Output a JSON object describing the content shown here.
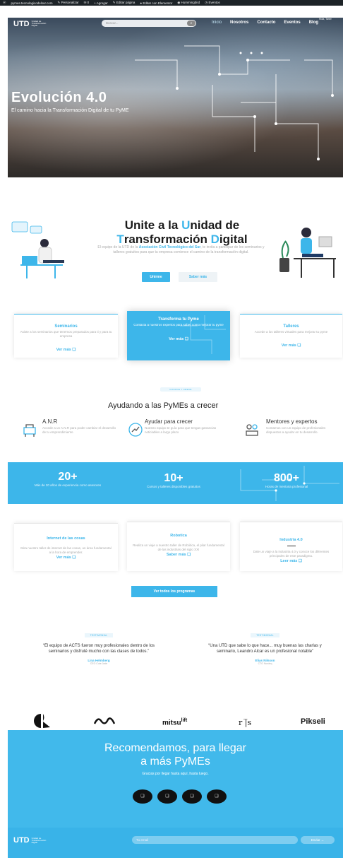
{
  "wpbar": {
    "site": "pymes.tecnologicodelsur.com",
    "customize": "Personalizar",
    "comments": "0",
    "new": "Agregar",
    "edit": "Editar página",
    "elementor": "Editar con Elementor",
    "notifications": "Hummingbird",
    "events": "Eventos"
  },
  "nav": {
    "logo": "UTD",
    "logo_sub": "Unidad de Transformación Digital",
    "search_placeholder": "Buscar...",
    "hello": "Hola, Taner",
    "items": [
      "Inicio",
      "Nosotros",
      "Contacto",
      "Eventos",
      "Blog"
    ]
  },
  "hero": {
    "title": "Evolución 4.0",
    "subtitle": "El camino hacia la Transformación Digital de tu PyME"
  },
  "unite": {
    "line1a": "Unite a la ",
    "line1b": "U",
    "line1c": "nidad de",
    "line2a": "T",
    "line2b": "ransformación ",
    "line2c": "D",
    "line2d": "igital",
    "intro_a": "El equipo de la UTD de la ",
    "intro_strong": "Asociación Civil Tecnológico del Sur",
    "intro_b": ", te invita a participar de los seminarios y talleres gratuitos para que tu empresa comience el camino de la transformación digital.",
    "btn_join": "Unirme",
    "btn_more": "Saber más"
  },
  "cards": [
    {
      "title": "Seminarios",
      "desc": "Asiste a los seminarios que tenemos preparados para ti y para tu empresa",
      "more": "Ver más ❑"
    },
    {
      "title": "Transforma tu Pyme",
      "desc": "Contacta a nuestros expertos para saber como mejorar tu pyme",
      "more": "Ver más ❑"
    },
    {
      "title": "Talleres",
      "desc": "Accede a los talleres virtuales para mejorar tu pyme",
      "more": "Ver más ❑"
    }
  ],
  "help": {
    "pill": "CONOCE Y CRECE",
    "title": "Ayudando a las PyMEs a crecer",
    "items": [
      {
        "title": "A.N.R",
        "desc": "Accede a un A.N.R para poder cambiar el desarrollo de tu emprendimiento"
      },
      {
        "title": "Ayudar para crecer",
        "desc": "Nuestro equipo te guía para que tengas ganancias noticiables a largo plazo"
      },
      {
        "title": "Mentores y expertos",
        "desc": "Contamos con un equipo de profesionales dispuestos a ayudar en tu desarrollo."
      }
    ]
  },
  "stats": [
    {
      "n": "20+",
      "l": "Más de 20 años de experiencia como asesores"
    },
    {
      "n": "10+",
      "l": "Cursos y talleres disponibles gratuitos"
    },
    {
      "n": "800+",
      "l": "Horas de mentoria profesional"
    }
  ],
  "programs": [
    {
      "title": "Internet de las cosas",
      "desc": "Mira nuestro taller de internet de las cosas, un área fundamental a la hora de emprender.",
      "more": "Ver más ❑"
    },
    {
      "title": "Robotica",
      "desc": "Realiza un viaje a nuestro taller de Robótica, el pilar fundamental de las industrias del siglo XXI",
      "more": "Saber más ❑"
    },
    {
      "title": "Industria 4.0",
      "desc": "Dale un viaje a la industria 4.0 y conoce los diferentes principales de este paradigma.",
      "more": "Leer más ❑"
    }
  ],
  "all_programs": "Ver todos los programas",
  "testimonials": [
    {
      "tag": "TESTIMONIAL",
      "quote": "“El equipo de ACTS fueron muy profesionales dentro de los seminarios y disfruté mucho con las clases de todos.”",
      "name": "Lina Helmberg",
      "role": "CEO Cute Jade"
    },
    {
      "tag": "TESTIMONIAL",
      "quote": "“Una UTD que sabe lo que hace... muy buenas las charlas y seminario, Leandro Alcar es un profesional notable”",
      "name": "Elias Nilsson",
      "role": "CTO Nordeq"
    }
  ],
  "logos": [
    "mitsu",
    "lift",
    "r",
    "s",
    "Pikseli"
  ],
  "cta": {
    "title1": "Recomendamos, para llegar",
    "title2": "a más PyMEs",
    "sub": "Gracias por llegar hasta aquí, hasta luego.",
    "social": [
      "❑",
      "❑",
      "❑",
      "❑"
    ]
  },
  "footer": {
    "logo": "UTD",
    "logo_sub": "Unidad de Transformación Digital",
    "email_placeholder": "Tu email",
    "send": "Enviar →"
  },
  "colors": {
    "accent": "#3db6ea",
    "dark": "#1d2327"
  }
}
